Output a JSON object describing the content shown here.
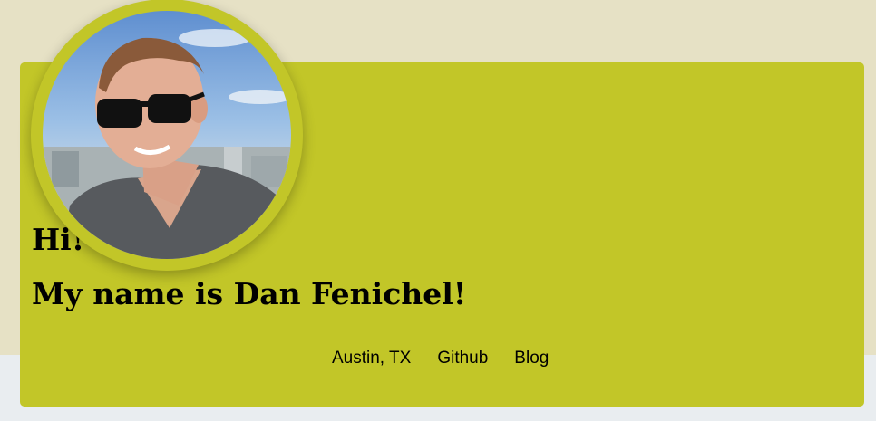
{
  "profile": {
    "greeting": "Hi!",
    "intro": "My name is Dan Fenichel!",
    "photo_alt": "profile photo of a man wearing sunglasses"
  },
  "links": [
    {
      "label": "Austin, TX"
    },
    {
      "label": "Github"
    },
    {
      "label": "Blog"
    }
  ],
  "colors": {
    "page_top": "#e6e1c5",
    "page_bottom": "#e9edf0",
    "card": "#c2c628",
    "text": "#000000"
  }
}
